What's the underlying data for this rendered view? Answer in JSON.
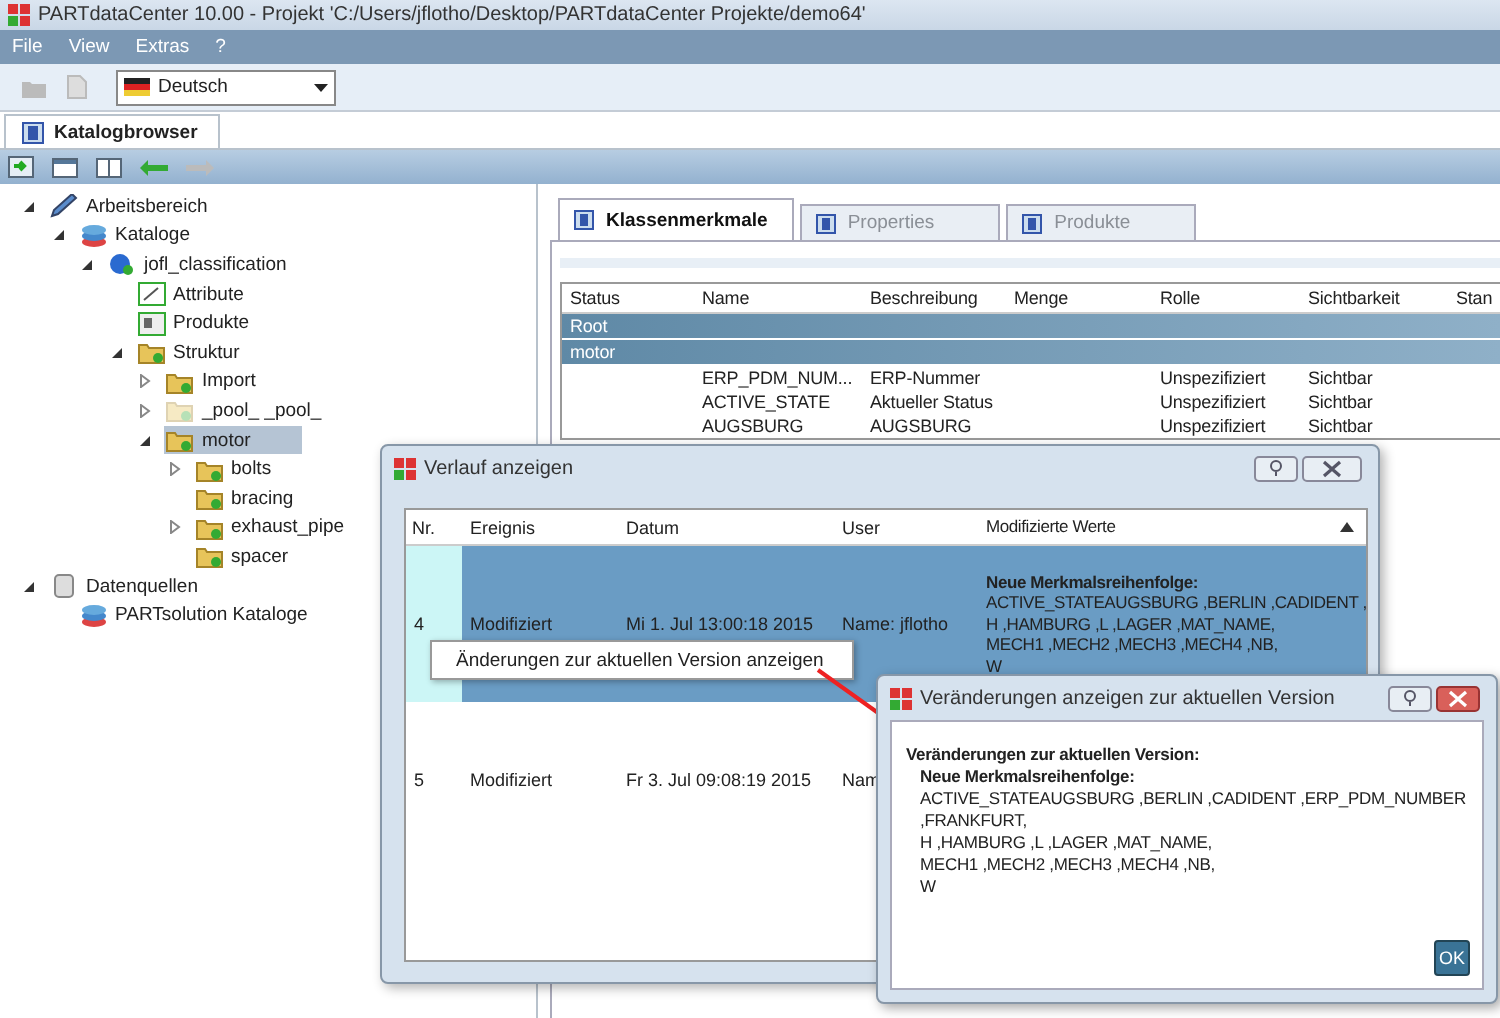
{
  "window": {
    "title": "PARTdataCenter 10.00 - Projekt 'C:/Users/jflotho/Desktop/PARTdataCenter Projekte/demo64'"
  },
  "menu": [
    "File",
    "View",
    "Extras",
    "?"
  ],
  "toolbar": {
    "language": "Deutsch"
  },
  "main_tabs": [
    {
      "label": "Katalogbrowser",
      "selected": true
    }
  ],
  "tree": [
    {
      "label": "Arbeitsbereich",
      "kind": "workspace",
      "expanded": true,
      "selected": false,
      "children": [
        {
          "label": "Kataloge",
          "kind": "catalogs",
          "expanded": true,
          "selected": false,
          "children": [
            {
              "label": "jofl_classification",
              "kind": "classification",
              "expanded": true,
              "selected": false,
              "children": [
                {
                  "label": "Attribute",
                  "kind": "attributes",
                  "selected": false
                },
                {
                  "label": "Produkte",
                  "kind": "products",
                  "selected": false
                },
                {
                  "label": "Struktur",
                  "kind": "folder",
                  "expanded": true,
                  "selected": false,
                  "children": [
                    {
                      "label": "Import",
                      "kind": "folder",
                      "expanded": false,
                      "selected": false
                    },
                    {
                      "label": "_pool_ _pool_",
                      "kind": "faded-folder",
                      "expanded": false,
                      "selected": false
                    },
                    {
                      "label": "motor",
                      "kind": "folder",
                      "expanded": true,
                      "selected": true,
                      "children": [
                        {
                          "label": "bolts",
                          "kind": "folder",
                          "expanded": false,
                          "selected": false
                        },
                        {
                          "label": "bracing",
                          "kind": "folder",
                          "selected": false
                        },
                        {
                          "label": "exhaust_pipe",
                          "kind": "folder",
                          "expanded": false,
                          "selected": false
                        },
                        {
                          "label": "spacer",
                          "kind": "folder",
                          "selected": false
                        }
                      ]
                    }
                  ]
                }
              ]
            }
          ]
        }
      ]
    },
    {
      "label": "Datenquellen",
      "kind": "datasource",
      "expanded": true,
      "selected": false,
      "children": [
        {
          "label": "PARTsolution Kataloge",
          "kind": "catalogs",
          "selected": false
        }
      ]
    }
  ],
  "detail_tabs": [
    {
      "label": "Klassenmerkmale",
      "selected": true
    },
    {
      "label": "Properties",
      "selected": false
    },
    {
      "label": "Produkte",
      "selected": false
    }
  ],
  "table": {
    "columns": [
      "Status",
      "Name",
      "Beschreibung",
      "Menge",
      "Rolle",
      "Sichtbarkeit",
      "Stan"
    ],
    "rows": [
      {
        "kind": "group",
        "label": "Root"
      },
      {
        "kind": "group",
        "label": "motor"
      },
      {
        "kind": "item",
        "name": "ERP_PDM_NUM...",
        "description": "ERP-Nummer",
        "role": "Unspezifiziert",
        "visibility": "Sichtbar"
      },
      {
        "kind": "item",
        "name": "ACTIVE_STATE",
        "description": "Aktueller Status",
        "role": "Unspezifiziert",
        "visibility": "Sichtbar"
      },
      {
        "kind": "item",
        "name": "AUGSBURG",
        "description": "AUGSBURG",
        "role": "Unspezifiziert",
        "visibility": "Sichtbar"
      }
    ]
  },
  "history_dialog": {
    "title": "Verlauf anzeigen",
    "columns": [
      "Nr.",
      "Ereignis",
      "Datum",
      "User",
      "Modifizierte Werte"
    ],
    "rows": [
      {
        "nr": "4",
        "event": "Modifiziert",
        "date": "Mi 1. Jul 13:00:18 2015",
        "user": "Name: jflotho",
        "selected": true,
        "values_heading": "Neue Merkmalsreihenfolge:",
        "values": [
          "ACTIVE_STATEAUGSBURG ,BERLIN ,CADIDENT ,",
          "H ,HAMBURG ,L ,LAGER ,MAT_NAME,",
          "MECH1 ,MECH2 ,MECH3 ,MECH4 ,NB,",
          "W"
        ]
      },
      {
        "nr": "5",
        "event": "Modifiziert",
        "date": "Fr 3. Jul 09:08:19 2015",
        "user": "Nam",
        "selected": false
      }
    ]
  },
  "context_menu": [
    "Änderungen zur aktuellen Version anzeigen"
  ],
  "changes_dialog": {
    "title": "Veränderungen anzeigen zur aktuellen Version",
    "heading": "Veränderungen zur aktuellen Version:",
    "subheading": "Neue Merkmalsreihenfolge:",
    "lines": [
      "ACTIVE_STATEAUGSBURG ,BERLIN ,CADIDENT ,ERP_PDM_NUMBER",
      ",FRANKFURT,",
      "H ,HAMBURG ,L ,LAGER ,MAT_NAME,",
      "MECH1 ,MECH2 ,MECH3 ,MECH4 ,NB,",
      "W"
    ],
    "ok": "OK"
  }
}
